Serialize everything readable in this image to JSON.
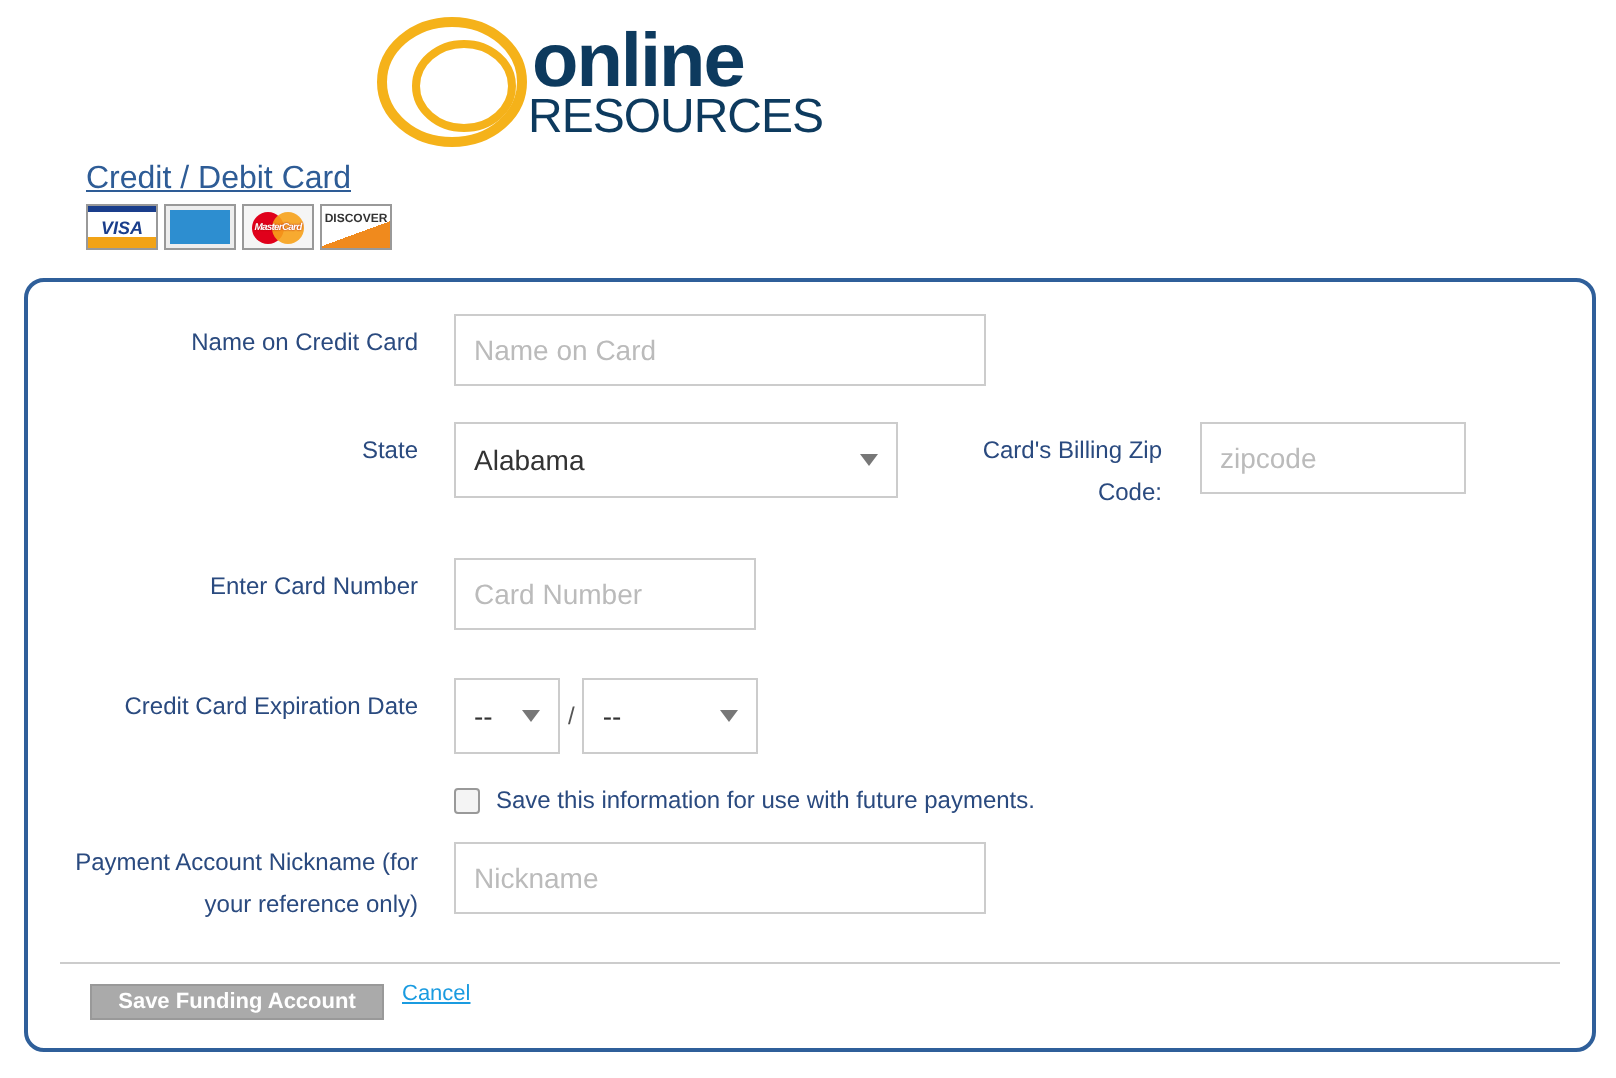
{
  "logo": {
    "word_top": "online",
    "word_bottom": "RESOURCES"
  },
  "heading": "Credit / Debit Card",
  "cards": [
    {
      "kind": "visa",
      "label": "VISA"
    },
    {
      "kind": "amex"
    },
    {
      "kind": "mastercard",
      "label": "MasterCard"
    },
    {
      "kind": "discover",
      "label": "DISCOVER"
    }
  ],
  "form": {
    "name": {
      "label": "Name on Credit Card",
      "placeholder": "Name on Card"
    },
    "state": {
      "label": "State",
      "value": "Alabama"
    },
    "zip": {
      "label": "Card's Billing Zip Code:",
      "placeholder": "zipcode"
    },
    "card_number": {
      "label": "Enter Card Number",
      "placeholder": "Card Number"
    },
    "expiration": {
      "label": "Credit Card Expiration Date",
      "month": "--",
      "separator": "/",
      "year": "--"
    },
    "save_info": {
      "label": "Save this information for use with future payments.",
      "checked": false
    },
    "nickname": {
      "label": "Payment Account Nickname (for your reference only)",
      "placeholder": "Nickname"
    }
  },
  "buttons": {
    "save": {
      "label": "Save Funding Account",
      "disabled": true
    },
    "cancel": "Cancel"
  }
}
